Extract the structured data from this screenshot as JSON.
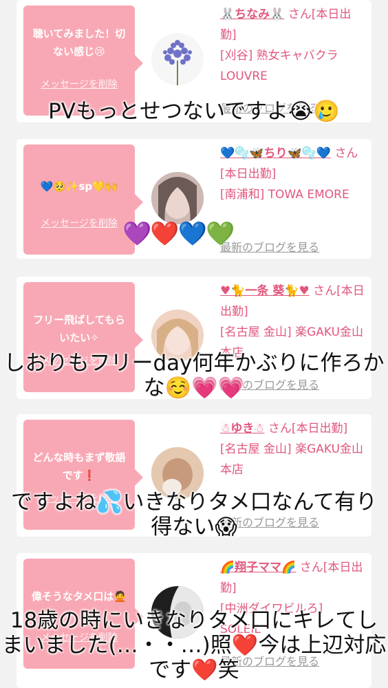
{
  "delete_label": "メッセージを削除",
  "blog_label": "最新のブログを見る",
  "colors": {
    "bubble": "#f8a8b4",
    "accent": "#e0577c",
    "link_gray": "#999999"
  },
  "cards": [
    {
      "message": "聴いてみました！切ない感じ😢",
      "name": "🐰ちなみ🐰",
      "status": " さん[本日出勤]",
      "shop": "[刈谷] 熟女キャバクラLOUVRE",
      "avatar_icon": "flower-avatar"
    },
    {
      "message": "💙🥺✨sp💛🙌",
      "name": "💙🫧🦋ちり🦋🫧💙",
      "status": " さん[本日出勤]",
      "shop": "[南浦和] TOWA EMORE",
      "avatar_icon": "portrait-avatar"
    },
    {
      "message": "フリー飛ばしてもらいたい✧",
      "name": "♥🐈一条 葵🐈♥",
      "status": " さん[本日出勤]",
      "shop": "[名古屋 金山] 楽GAKU金山本店",
      "avatar_icon": "portrait-avatar"
    },
    {
      "message": "どんな時もまず敬語です❗",
      "name": "☃ゆき☃",
      "status": " さん[本日出勤]",
      "shop": "[名古屋 金山] 楽GAKU金山本店",
      "avatar_icon": "portrait-avatar"
    },
    {
      "message": "偉そうなタメ口は🙅",
      "name": "🌈翔子ママ🌈",
      "status": " さん[本日出勤]",
      "shop": "[中洲ダイワビルろ] SOLEIL",
      "avatar_icon": "portrait-avatar"
    }
  ],
  "overlays": [
    "PVもっとせつないですよ😭🥲",
    "💜❤️💙💚",
    "しおりもフリーday何年かぶりに作ろかな☺️💗💗",
    "ですよね💦いきなりタメ口なんて有り得ない😱",
    "18歳の時にいきなりタメ口にキレてしまいました(…・・…)照❤️今は上辺対応です❤️笑"
  ]
}
